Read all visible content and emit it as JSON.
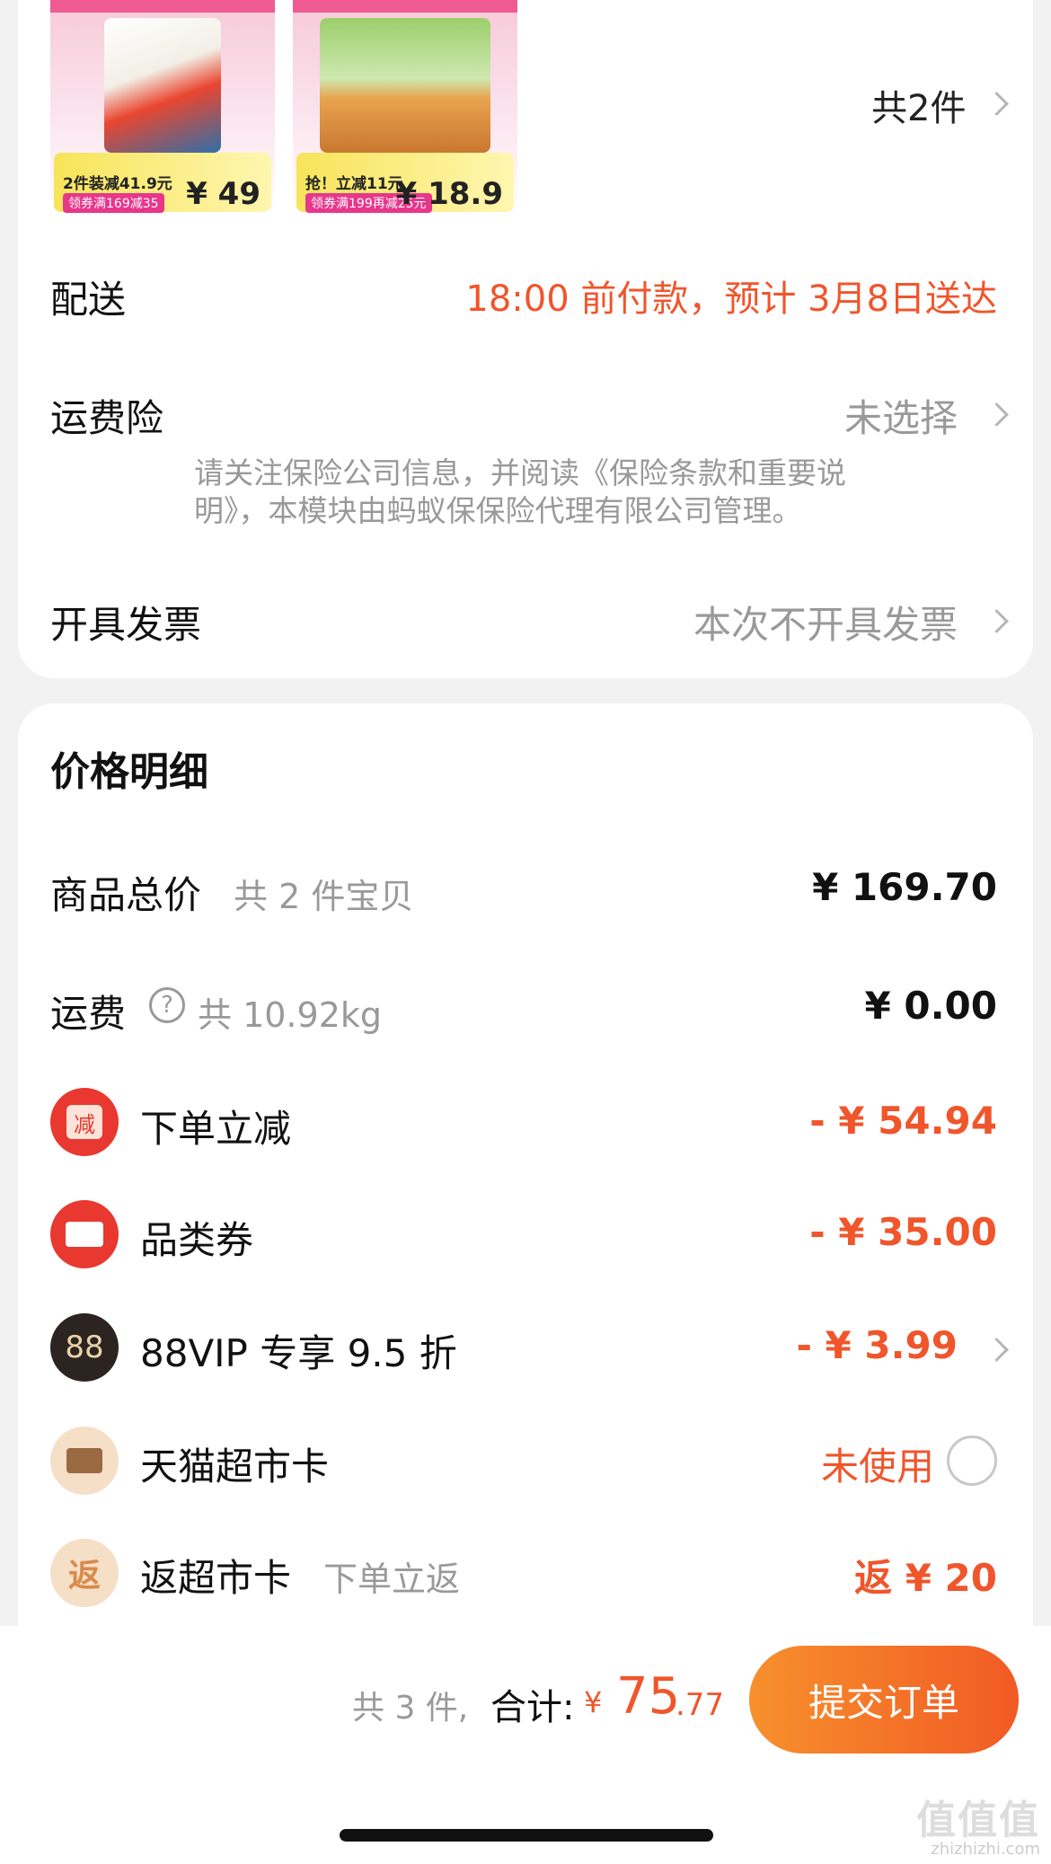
{
  "products": {
    "count_label": "共2件",
    "items": [
      {
        "promo": "2件装减41.9元",
        "coupon": "领券满169减35",
        "price": "¥ 49"
      },
      {
        "promo": "抢！立减11元",
        "coupon": "领券满199再减25元",
        "price": "¥ 18.9"
      }
    ]
  },
  "delivery": {
    "label": "配送",
    "value": "18:00 前付款，预计 3月8日送达"
  },
  "insurance": {
    "label": "运费险",
    "value": "未选择",
    "note_line1": "请关注保险公司信息，并阅读《保险条款和重要说",
    "note_line2": "明》，本模块由蚂蚁保保险代理有限公司管理。"
  },
  "invoice": {
    "label": "开具发票",
    "value": "本次不开具发票"
  },
  "price_detail": {
    "title": "价格明细",
    "goods_total": {
      "label": "商品总价",
      "sub": "共 2 件宝贝",
      "value": "¥ 169.70"
    },
    "shipping": {
      "label": "运费",
      "help_icon": "question-circle-icon",
      "sub": "共 10.92kg",
      "value": "¥ 0.00"
    },
    "discounts": [
      {
        "icon": "jian-badge-icon",
        "icon_text": "减",
        "icon_color": "#e8382f",
        "label": "下单立减",
        "value": "- ¥ 54.94"
      },
      {
        "icon": "ticket-icon",
        "icon_color": "#e8382f",
        "label": "品类券",
        "value": "- ¥ 35.00"
      },
      {
        "icon": "88vip-icon",
        "icon_text": "88",
        "icon_color": "#2b2420",
        "label": "88VIP 专享 9.5 折",
        "value": "- ¥ 3.99"
      },
      {
        "icon": "card-icon",
        "icon_color": "#f5dfc7",
        "label": "天猫超市卡",
        "value": "未使用"
      },
      {
        "icon": "fan-badge-icon",
        "icon_text": "返",
        "icon_color": "#f5dfc7",
        "label": "返超市卡",
        "sub": "下单立返",
        "value": "返 ¥ 20"
      }
    ]
  },
  "footer": {
    "count": "共 3 件,",
    "total_label": "合计:",
    "currency": "¥",
    "total_int": "75",
    "total_dec": ".77",
    "submit_label": "提交订单"
  },
  "watermark": {
    "main": "值值值",
    "sub": "zhizhizhi.com"
  },
  "colors": {
    "accent": "#f0552b",
    "submit_start": "#f7902d",
    "submit_end": "#f15a24"
  }
}
